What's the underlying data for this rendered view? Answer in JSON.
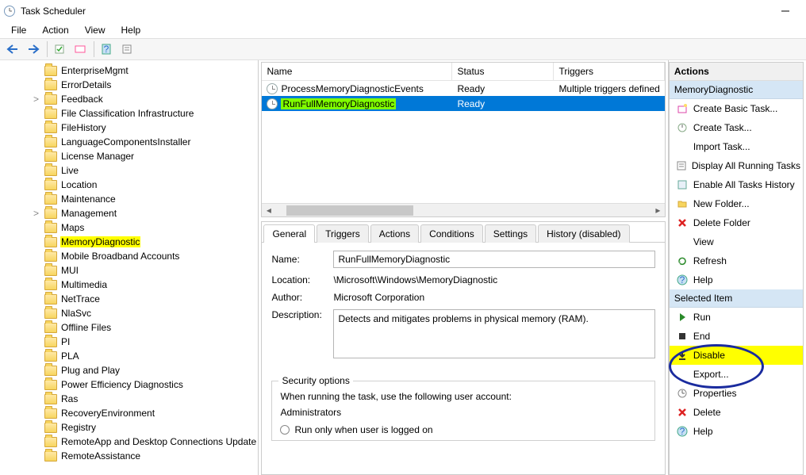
{
  "window": {
    "title": "Task Scheduler"
  },
  "menu": {
    "file": "File",
    "action": "Action",
    "view": "View",
    "help": "Help"
  },
  "tree": {
    "items": [
      {
        "label": "EnterpriseMgmt"
      },
      {
        "label": "ErrorDetails"
      },
      {
        "label": "Feedback",
        "exp": ">"
      },
      {
        "label": "File Classification Infrastructure"
      },
      {
        "label": "FileHistory"
      },
      {
        "label": "LanguageComponentsInstaller"
      },
      {
        "label": "License Manager"
      },
      {
        "label": "Live"
      },
      {
        "label": "Location"
      },
      {
        "label": "Maintenance"
      },
      {
        "label": "Management",
        "exp": ">"
      },
      {
        "label": "Maps"
      },
      {
        "label": "MemoryDiagnostic",
        "hl": true
      },
      {
        "label": "Mobile Broadband Accounts"
      },
      {
        "label": "MUI"
      },
      {
        "label": "Multimedia"
      },
      {
        "label": "NetTrace"
      },
      {
        "label": "NlaSvc"
      },
      {
        "label": "Offline Files"
      },
      {
        "label": "PI"
      },
      {
        "label": "PLA"
      },
      {
        "label": "Plug and Play"
      },
      {
        "label": "Power Efficiency Diagnostics"
      },
      {
        "label": "Ras"
      },
      {
        "label": "RecoveryEnvironment"
      },
      {
        "label": "Registry"
      },
      {
        "label": "RemoteApp and Desktop Connections Update"
      },
      {
        "label": "RemoteAssistance"
      }
    ]
  },
  "tasks": {
    "headers": {
      "name": "Name",
      "status": "Status",
      "triggers": "Triggers"
    },
    "rows": [
      {
        "name": "ProcessMemoryDiagnosticEvents",
        "status": "Ready",
        "triggers": "Multiple triggers defined",
        "selected": false
      },
      {
        "name": "RunFullMemoryDiagnostic",
        "status": "Ready",
        "triggers": "",
        "selected": true,
        "nameHl": true
      }
    ]
  },
  "tabs": {
    "general": "General",
    "triggers": "Triggers",
    "actions": "Actions",
    "conditions": "Conditions",
    "settings": "Settings",
    "history": "History (disabled)"
  },
  "general": {
    "nameLabel": "Name:",
    "nameValue": "RunFullMemoryDiagnostic",
    "locationLabel": "Location:",
    "locationValue": "\\Microsoft\\Windows\\MemoryDiagnostic",
    "authorLabel": "Author:",
    "authorValue": "Microsoft Corporation",
    "descriptionLabel": "Description:",
    "descriptionValue": "Detects and mitigates problems in physical memory (RAM).",
    "securityLegend": "Security options",
    "securityText": "When running the task, use the following user account:",
    "securityAccount": "Administrators",
    "runOnlyLogged": "Run only when user is logged on"
  },
  "actions": {
    "header": "Actions",
    "group1": "MemoryDiagnostic",
    "items1": [
      {
        "label": "Create Basic Task...",
        "ico": "wizard"
      },
      {
        "label": "Create Task...",
        "ico": "task"
      },
      {
        "label": "Import Task...",
        "ico": ""
      },
      {
        "label": "Display All Running Tasks",
        "ico": "list"
      },
      {
        "label": "Enable All Tasks History",
        "ico": "hist"
      },
      {
        "label": "New Folder...",
        "ico": "folder"
      },
      {
        "label": "Delete Folder",
        "ico": "delete"
      },
      {
        "label": "View",
        "ico": ""
      },
      {
        "label": "Refresh",
        "ico": "refresh"
      },
      {
        "label": "Help",
        "ico": "help"
      }
    ],
    "group2": "Selected Item",
    "items2": [
      {
        "label": "Run",
        "ico": "run"
      },
      {
        "label": "End",
        "ico": "end"
      },
      {
        "label": "Disable",
        "ico": "disable",
        "hl": true
      },
      {
        "label": "Export...",
        "ico": ""
      },
      {
        "label": "Properties",
        "ico": "props"
      },
      {
        "label": "Delete",
        "ico": "delete"
      },
      {
        "label": "Help",
        "ico": "help"
      }
    ]
  }
}
